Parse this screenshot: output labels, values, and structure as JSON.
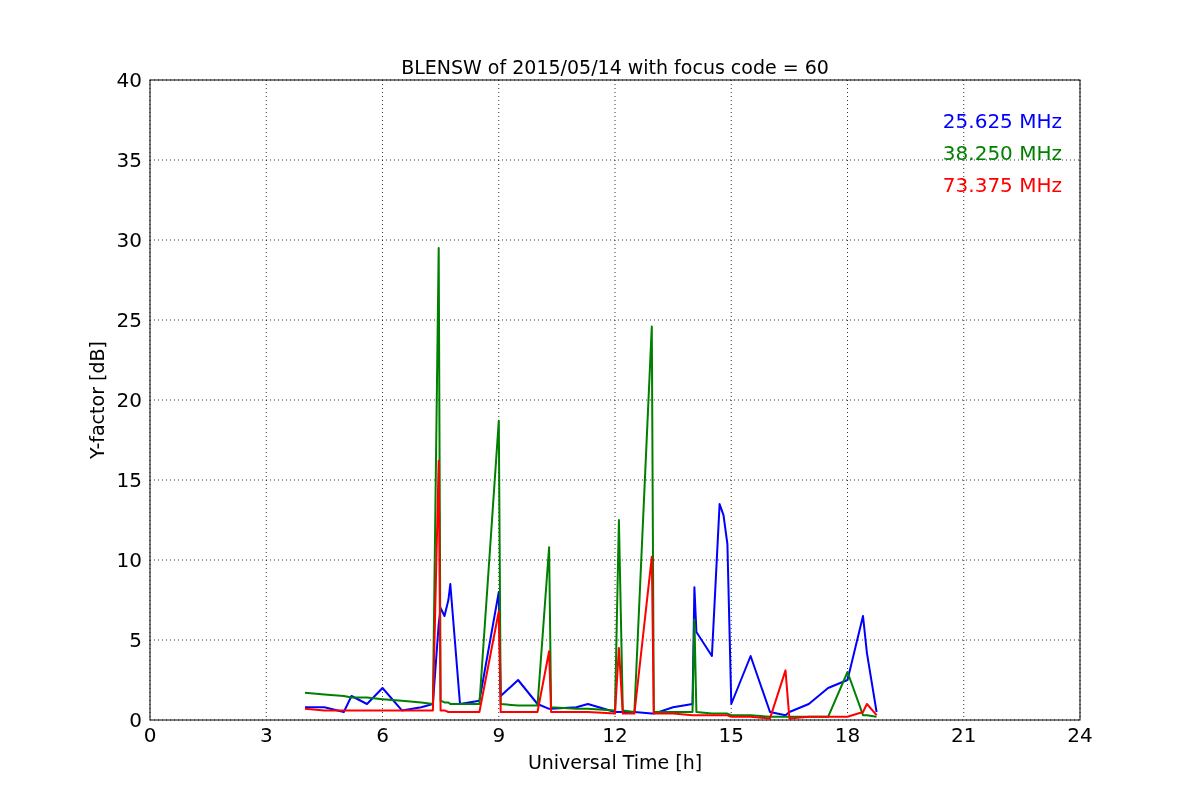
{
  "chart_data": {
    "type": "line",
    "title": "BLENSW of 2015/05/14 with focus code = 60",
    "xlabel": "Universal Time [h]",
    "ylabel": "Y-factor [dB]",
    "xlim": [
      0,
      24
    ],
    "ylim": [
      0,
      40
    ],
    "xticks": [
      0,
      3,
      6,
      9,
      12,
      15,
      18,
      21,
      24
    ],
    "yticks": [
      0,
      5,
      10,
      15,
      20,
      25,
      30,
      35,
      40
    ],
    "grid": true,
    "x": [
      4,
      4.5,
      5,
      5.2,
      5.6,
      6,
      6.5,
      7,
      7.3,
      7.45,
      7.5,
      7.6,
      7.7,
      7.75,
      8,
      8.5,
      9,
      9.05,
      9.5,
      10,
      10.3,
      10.35,
      11,
      11.3,
      12,
      12.1,
      12.2,
      12.5,
      12.95,
      13,
      13.5,
      14,
      14.05,
      14.1,
      14.5,
      14.7,
      14.8,
      14.9,
      15,
      15.5,
      16,
      16.4,
      16.5,
      17,
      17.5,
      18,
      18.4,
      18.5,
      18.75
    ],
    "series": [
      {
        "name": "25.625 MHz",
        "color": "#0000ff",
        "values": [
          0.8,
          0.8,
          0.5,
          1.5,
          1.0,
          2.0,
          0.6,
          0.8,
          1.0,
          6.0,
          7.0,
          6.5,
          7.5,
          8.5,
          1.0,
          1.2,
          8.0,
          1.5,
          2.5,
          1.0,
          0.7,
          0.7,
          0.8,
          1.0,
          0.5,
          0.5,
          0.5,
          0.5,
          0.4,
          0.4,
          0.8,
          1.0,
          8.3,
          5.5,
          4.0,
          13.5,
          12.8,
          11.0,
          1.0,
          4.0,
          0.5,
          0.3,
          0.5,
          1.0,
          2.0,
          2.5,
          6.5,
          4.2,
          0.5
        ]
      },
      {
        "name": "38.250 MHz",
        "color": "#008000",
        "values": [
          1.7,
          1.6,
          1.5,
          1.4,
          1.4,
          1.3,
          1.2,
          1.1,
          1.0,
          29.5,
          1.2,
          1.1,
          1.1,
          1.0,
          1.0,
          1.0,
          18.7,
          1.0,
          0.9,
          0.9,
          10.8,
          0.8,
          0.7,
          0.7,
          0.6,
          12.5,
          0.6,
          0.5,
          24.6,
          0.5,
          0.5,
          0.5,
          6.3,
          0.5,
          0.4,
          0.4,
          0.4,
          0.4,
          0.3,
          0.3,
          0.2,
          0.2,
          0.2,
          0.2,
          0.2,
          3.0,
          0.3,
          0.3,
          0.2
        ]
      },
      {
        "name": "73.375 MHz",
        "color": "#ff0000",
        "values": [
          0.7,
          0.6,
          0.6,
          0.6,
          0.6,
          0.6,
          0.6,
          0.6,
          0.6,
          16.2,
          0.6,
          0.6,
          0.5,
          0.5,
          0.5,
          0.5,
          6.8,
          0.5,
          0.5,
          0.5,
          4.3,
          0.5,
          0.5,
          0.5,
          0.4,
          4.5,
          0.4,
          0.4,
          10.2,
          0.4,
          0.4,
          0.3,
          0.3,
          0.3,
          0.3,
          0.3,
          0.3,
          0.3,
          0.2,
          0.2,
          0.1,
          3.1,
          0.1,
          0.2,
          0.2,
          0.2,
          0.5,
          1.0,
          0.3
        ]
      }
    ]
  }
}
